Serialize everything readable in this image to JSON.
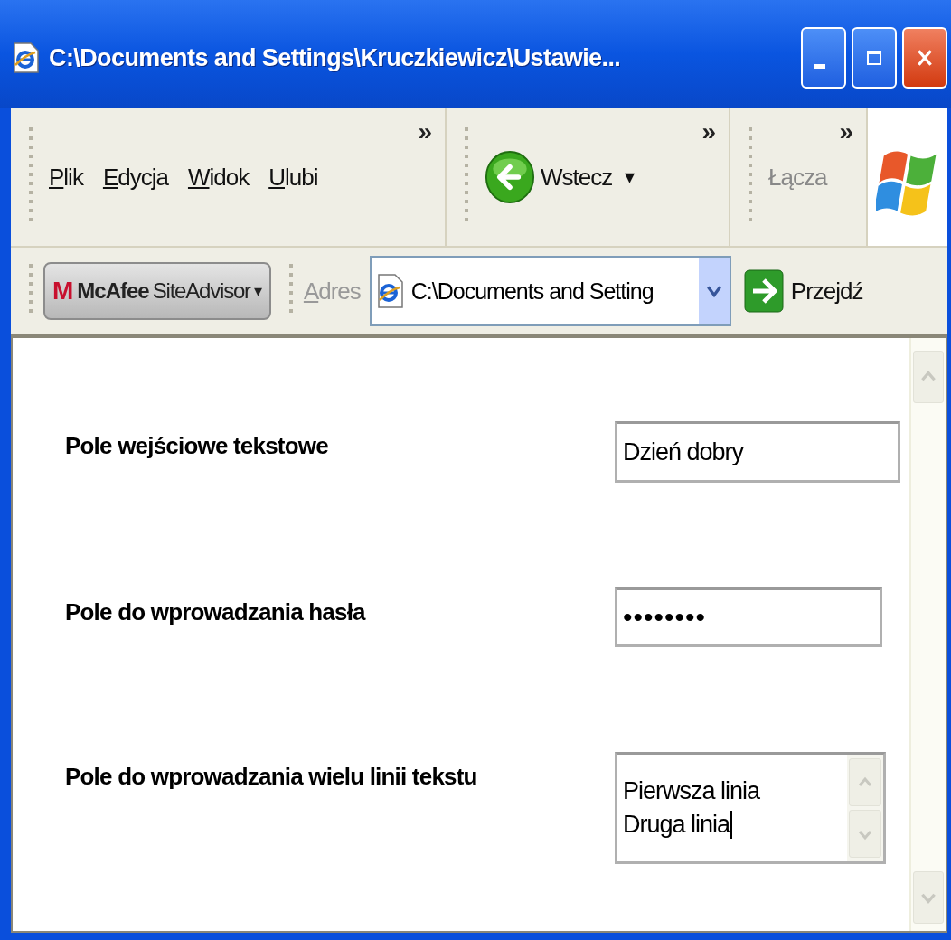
{
  "window": {
    "title": "C:\\Documents and Settings\\Kruczkiewicz\\Ustawie..."
  },
  "menu_bar": {
    "items": [
      "Plik",
      "Edycja",
      "Widok",
      "Ulubi"
    ],
    "chevron": "»"
  },
  "nav_toolbar": {
    "back_label": "Wstecz",
    "dropdown": "▾",
    "chevron": "»"
  },
  "links_toolbar": {
    "label": "Łącza",
    "chevron": "»"
  },
  "address_bar": {
    "siteadvisor": {
      "logo": "M",
      "brand": "McAfee",
      "product": "SiteAdvisor",
      "dropdown": "▾"
    },
    "label": "Adres",
    "url": "C:\\Documents and Setting",
    "go_label": "Przejdź"
  },
  "form": {
    "fields": [
      {
        "kind": "text",
        "label": "Pole wejściowe tekstowe",
        "value": "Dzień dobry"
      },
      {
        "kind": "password",
        "label": "Pole do wprowadzania hasła",
        "value": "••••••••"
      },
      {
        "kind": "textarea",
        "label": "Pole do wprowadzania wielu linii tekstu",
        "lines": [
          "Pierwsza linia",
          "Druga linia"
        ]
      }
    ]
  }
}
